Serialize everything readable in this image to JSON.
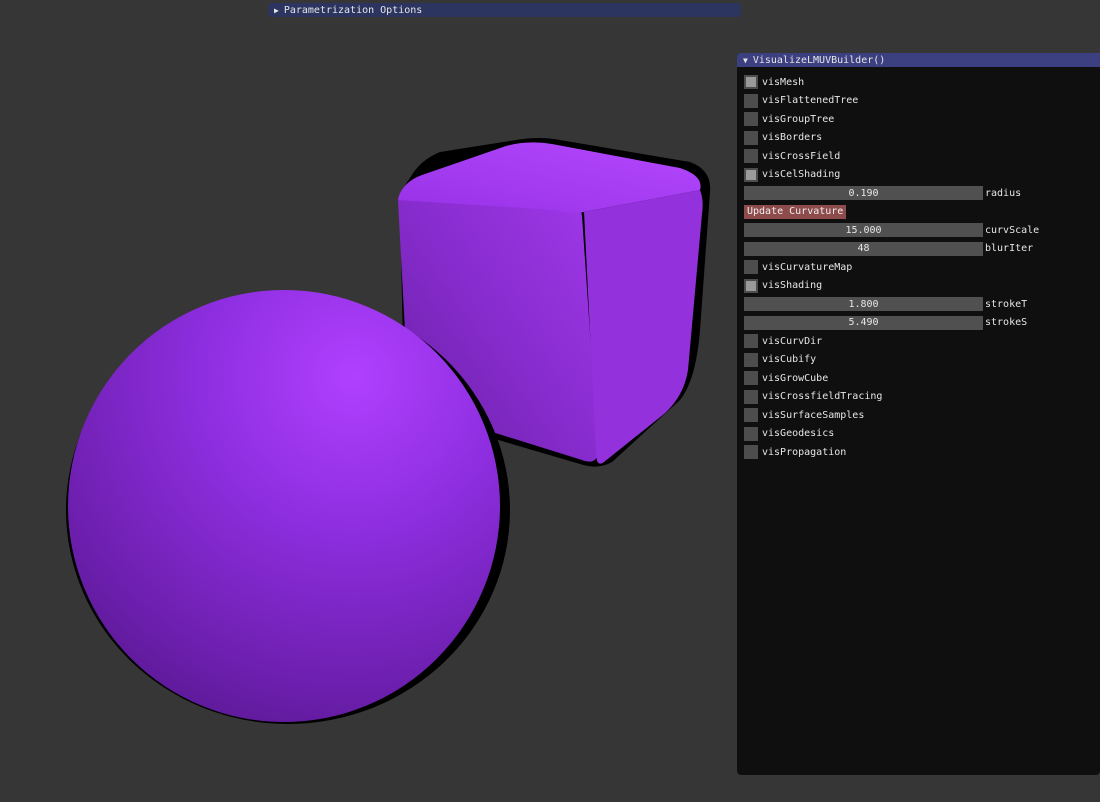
{
  "param_window": {
    "title": "Parametrization Options",
    "collapsed": true
  },
  "vis_window": {
    "title": "VisualizeLMUVBuilder()",
    "checkboxes": [
      {
        "label": "visMesh",
        "checked": true
      },
      {
        "label": "visFlattenedTree",
        "checked": false
      },
      {
        "label": "visGroupTree",
        "checked": false
      },
      {
        "label": "visBorders",
        "checked": false
      },
      {
        "label": "visCrossField",
        "checked": false
      },
      {
        "label": "visCelShading",
        "checked": true
      }
    ],
    "radius": {
      "value": "0.190",
      "label": "radius"
    },
    "update_button": "Update Curvature",
    "curv_scale": {
      "value": "15.000",
      "label": "curvScale"
    },
    "blur_iter": {
      "value": "48",
      "label": "blurIter"
    },
    "vis_curvature_map": {
      "label": "visCurvatureMap",
      "checked": false
    },
    "vis_shading": {
      "label": "visShading",
      "checked": true
    },
    "stroke_t": {
      "value": "1.800",
      "label": "strokeT"
    },
    "stroke_s": {
      "value": "5.490",
      "label": "strokeS"
    },
    "checkboxes2": [
      {
        "label": "visCurvDir",
        "checked": false
      },
      {
        "label": "visCubify",
        "checked": false
      },
      {
        "label": "visGrowCube",
        "checked": false
      },
      {
        "label": "visCrossfieldTracing",
        "checked": false
      },
      {
        "label": "visSurfaceSamples",
        "checked": false
      },
      {
        "label": "visGeodesics",
        "checked": false
      },
      {
        "label": "visPropagation",
        "checked": false
      }
    ]
  },
  "scene": {
    "background": "#363636",
    "mesh_color": "#8a2be2"
  }
}
